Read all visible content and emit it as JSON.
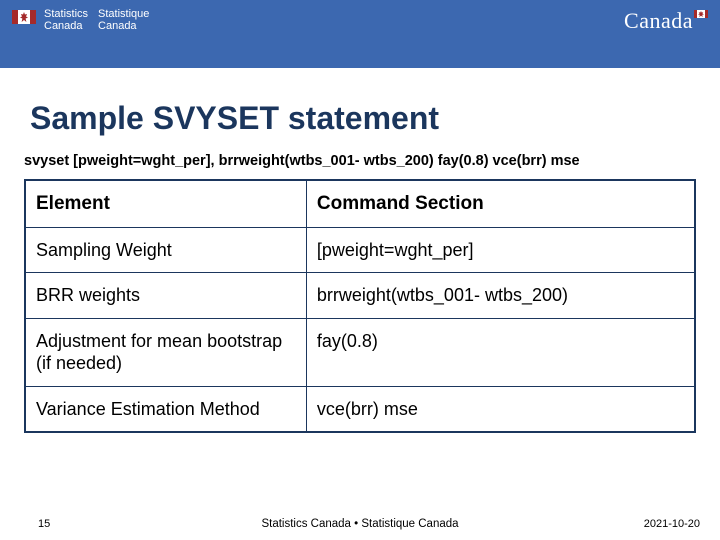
{
  "header": {
    "gov_left_en_line1": "Statistics",
    "gov_left_en_line2": "Canada",
    "gov_left_fr_line1": "Statistique",
    "gov_left_fr_line2": "Canada",
    "gov_right": "Canada"
  },
  "title": "Sample SVYSET statement",
  "command_line": "svyset [pweight=wght_per], brrweight(wtbs_001- wtbs_200) fay(0.8) vce(brr) mse",
  "table": {
    "headers": {
      "element": "Element",
      "section": "Command Section"
    },
    "rows": [
      {
        "element": "Sampling Weight",
        "section": "[pweight=wght_per]"
      },
      {
        "element": "BRR weights",
        "section": "brrweight(wtbs_001- wtbs_200)"
      },
      {
        "element": "Adjustment for mean bootstrap (if needed)",
        "section": "fay(0.8)"
      },
      {
        "element": "Variance Estimation Method",
        "section": "vce(brr) mse"
      }
    ]
  },
  "footer": {
    "page_number": "15",
    "center_text": "Statistics Canada • Statistique Canada",
    "date": "2021-10-20"
  }
}
